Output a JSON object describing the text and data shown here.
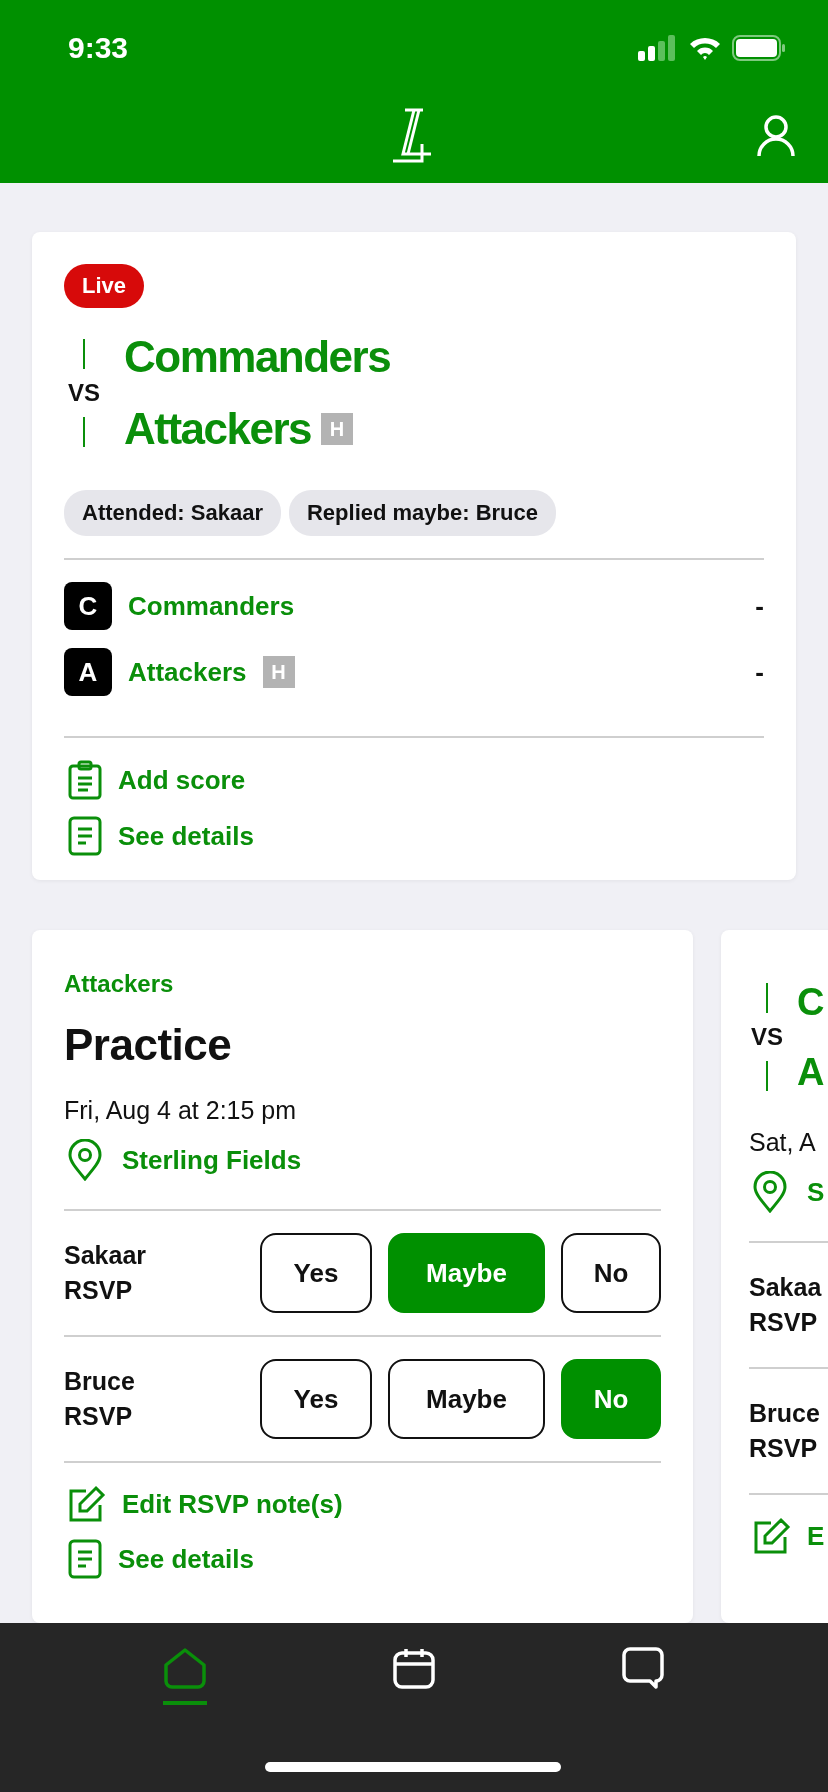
{
  "status_bar": {
    "time": "9:33"
  },
  "live_card": {
    "badge": "Live",
    "vs": "VS",
    "matchup": [
      {
        "name": "Commanders"
      },
      {
        "name": "Attackers",
        "badge": "H"
      }
    ],
    "chips": [
      "Attended: Sakaar",
      "Replied maybe: Bruce"
    ],
    "teams": [
      {
        "initial": "C",
        "name": "Commanders",
        "score": "-"
      },
      {
        "initial": "A",
        "name": "Attackers",
        "badge": "H",
        "score": "-"
      }
    ],
    "actions": [
      {
        "kind": "add_score",
        "label": "Add score"
      },
      {
        "kind": "details",
        "label": "See details"
      }
    ]
  },
  "event_cards": [
    {
      "kind": "practice",
      "team": "Attackers",
      "title": "Practice",
      "datetime": "Fri, Aug 4 at 2:15 pm",
      "location": "Sterling Fields",
      "rsvps": [
        {
          "name": "Sakaar",
          "label": "RSVP",
          "options": [
            {
              "label": "Yes",
              "selected": false
            },
            {
              "label": "Maybe",
              "selected": true
            },
            {
              "label": "No",
              "selected": false
            }
          ]
        },
        {
          "name": "Bruce",
          "label": "RSVP",
          "options": [
            {
              "label": "Yes",
              "selected": false
            },
            {
              "label": "Maybe",
              "selected": false
            },
            {
              "label": "No",
              "selected": true
            }
          ]
        }
      ],
      "actions": [
        {
          "kind": "edit",
          "label": "Edit RSVP note(s)"
        },
        {
          "kind": "details",
          "label": "See details"
        }
      ]
    },
    {
      "kind": "game",
      "vs": "VS",
      "matchup": [
        {
          "name": "C"
        },
        {
          "name": "A"
        }
      ],
      "datetime": "Sat, A",
      "location": "S",
      "rsvps": [
        {
          "name": "Sakaa",
          "label": "RSVP"
        },
        {
          "name": "Bruce",
          "label": "RSVP"
        }
      ],
      "actions": [
        {
          "kind": "edit",
          "label": "E"
        }
      ]
    }
  ],
  "tab_bar": [
    {
      "kind": "home",
      "selected": true
    },
    {
      "kind": "calendar",
      "selected": false
    },
    {
      "kind": "chat",
      "selected": false
    }
  ]
}
